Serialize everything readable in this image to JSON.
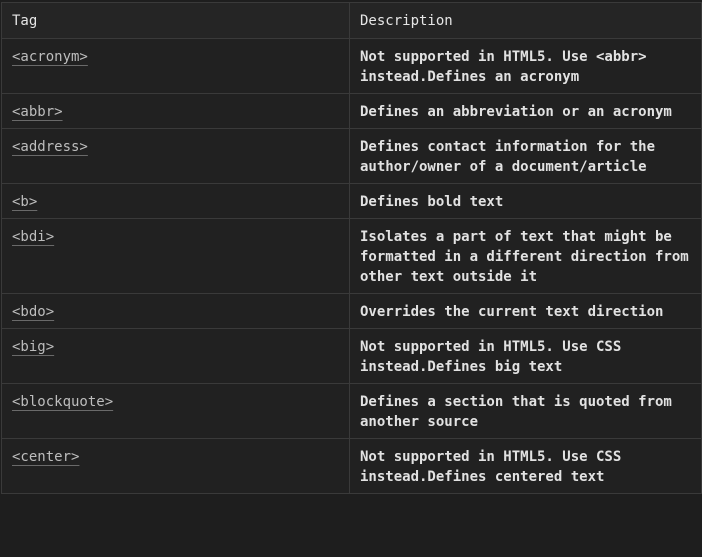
{
  "table": {
    "headers": [
      "Tag",
      "Description"
    ],
    "rows": [
      {
        "tag": "<acronym>",
        "description": "Not supported in HTML5. Use <abbr> instead.Defines an acronym"
      },
      {
        "tag": "<abbr>",
        "description": "Defines an abbreviation or an acronym"
      },
      {
        "tag": "<address>",
        "description": "Defines contact information for the author/owner of a document/article"
      },
      {
        "tag": "<b>",
        "description": "Defines bold text"
      },
      {
        "tag": "<bdi>",
        "description": "Isolates a part of text that might be formatted in a different direction from other text outside it"
      },
      {
        "tag": "<bdo>",
        "description": "Overrides the current text direction"
      },
      {
        "tag": "<big>",
        "description": "Not supported in HTML5. Use CSS instead.Defines big text"
      },
      {
        "tag": "<blockquote>",
        "description": "Defines a section that is quoted from another source"
      },
      {
        "tag": "<center>",
        "description": "Not supported in HTML5. Use CSS instead.Defines centered text"
      }
    ]
  }
}
